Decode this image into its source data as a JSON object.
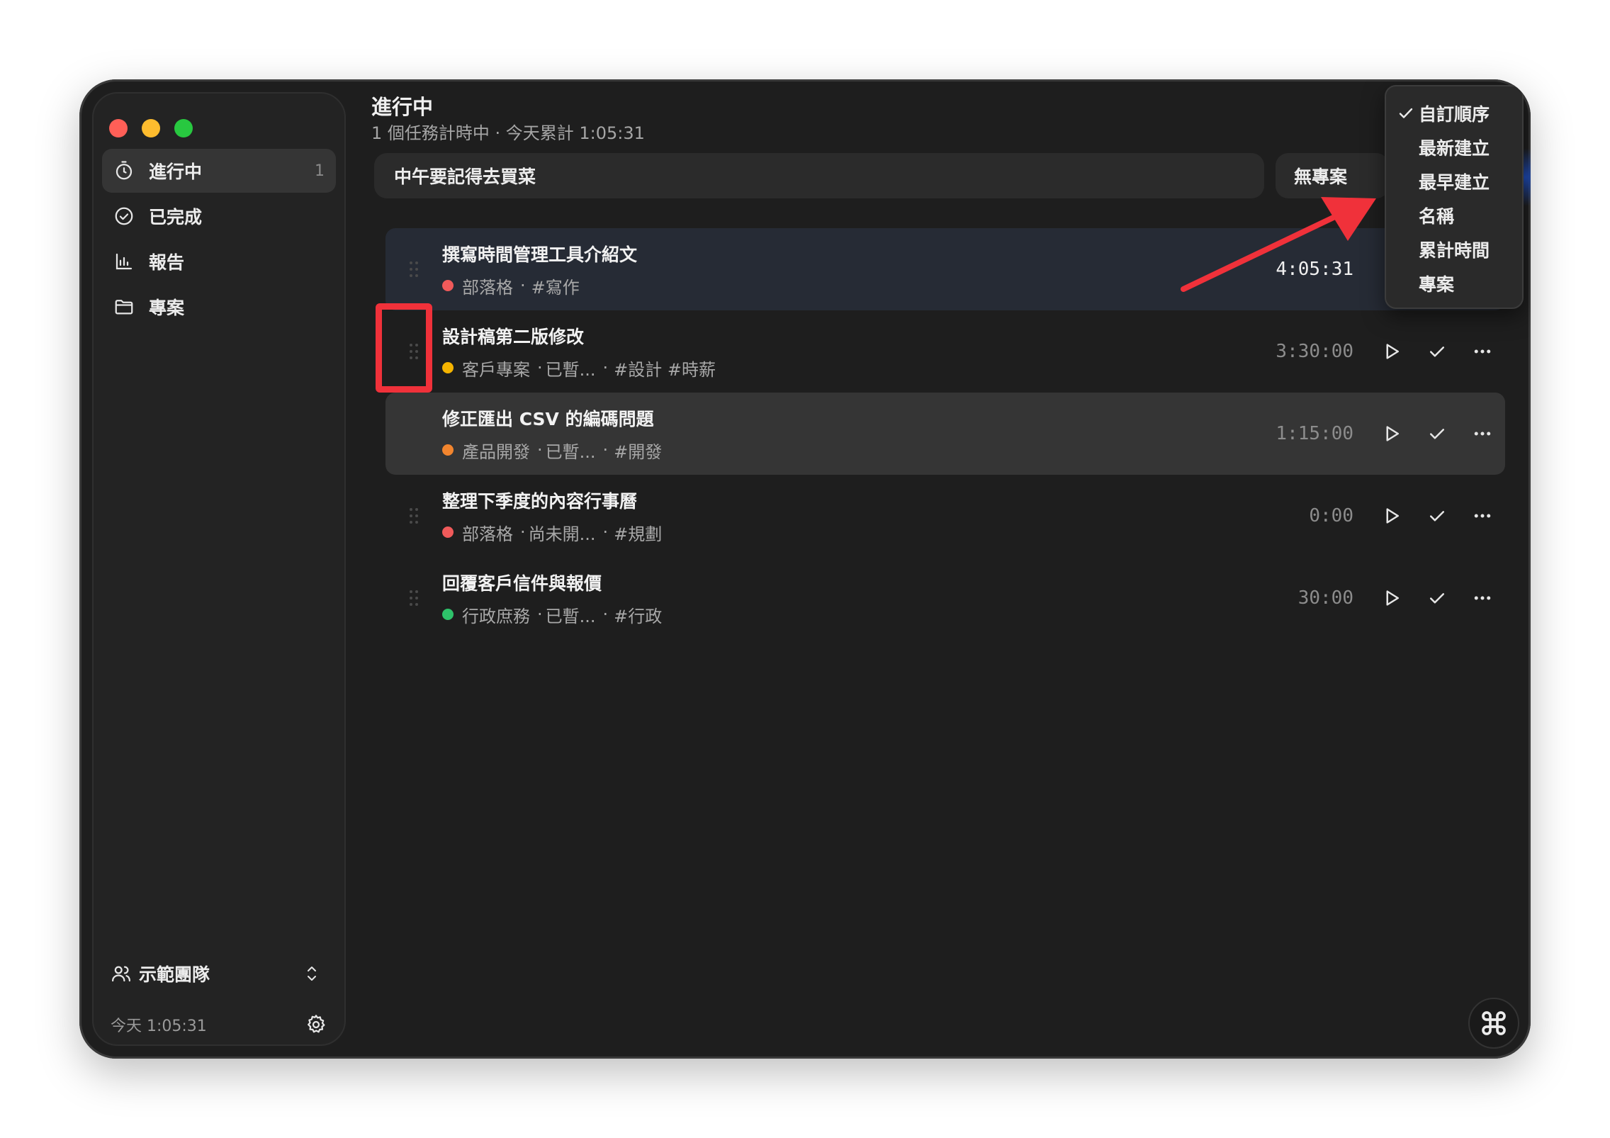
{
  "sidebar": {
    "nav": [
      {
        "label": "進行中",
        "icon": "timer-icon",
        "count": "1",
        "active": true
      },
      {
        "label": "已完成",
        "icon": "check-circle-icon",
        "count": ""
      },
      {
        "label": "報告",
        "icon": "bar-chart-icon",
        "count": ""
      },
      {
        "label": "專案",
        "icon": "folder-icon",
        "count": ""
      }
    ],
    "team": "示範團隊",
    "today": "今天 1:05:31"
  },
  "main": {
    "title": "進行中",
    "subtitle": "1 個任務計時中 · 今天累計 1:05:31",
    "new_task_input": "中午要記得去買菜",
    "project_select": "無專案"
  },
  "tasks": [
    {
      "name": "撰寫時間管理工具介紹文",
      "project": "部落格",
      "status": "",
      "tags": "#寫作",
      "time": "4:05:31",
      "dot": "#f05a5a",
      "state": "running"
    },
    {
      "name": "設計稿第二版修改",
      "project": "客戶專案",
      "status": "已暫...",
      "tags": "#設計 #時薪",
      "time": "3:30:00",
      "dot": "#f5b400",
      "state": "paused"
    },
    {
      "name": "修正匯出 CSV 的編碼問題",
      "project": "產品開發",
      "status": "已暫...",
      "tags": "#開發",
      "time": "1:15:00",
      "dot": "#f2852e",
      "state": "hover"
    },
    {
      "name": "整理下季度的內容行事曆",
      "project": "部落格",
      "status": "尚未開...",
      "tags": "#規劃",
      "time": "0:00",
      "dot": "#f05a5a",
      "state": "idle"
    },
    {
      "name": "回覆客戶信件與報價",
      "project": "行政庶務",
      "status": "已暫...",
      "tags": "#行政",
      "time": "30:00",
      "dot": "#2ec26a",
      "state": "idle"
    }
  ],
  "sort_menu": {
    "options": [
      "自訂順序",
      "最新建立",
      "最早建立",
      "名稱",
      "累計時間",
      "專案"
    ],
    "selected": "自訂順序"
  },
  "colors": {
    "annotation": "#f0313a",
    "accent_blue": "#1e50c8"
  }
}
